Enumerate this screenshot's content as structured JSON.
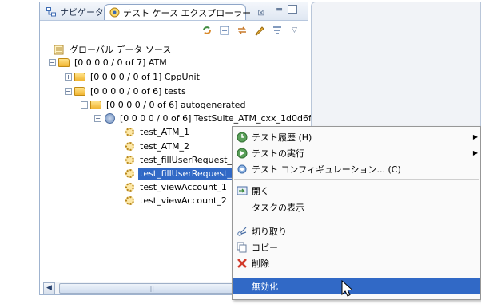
{
  "tabs": {
    "navigator": {
      "label": "ナビゲーター"
    },
    "explorer": {
      "label": "テスト ケース エクスプローラー",
      "close": "⊠"
    }
  },
  "tree": {
    "global_source": "グローバル データ ソース",
    "atm": "[0 0 0 0 / 0 of 7] ATM",
    "cppunit": "[0 0 0 0 / 0 of 1] CppUnit",
    "tests": "[0 0 0 0 / 0 of 6] tests",
    "autogenerated": "[0 0 0 0 / 0 of 6] autogenerated",
    "suite": "[0 0 0 0 / 0 of 6] TestSuite_ATM_cxx_1d0d6f",
    "cases": [
      "test_ATM_1",
      "test_ATM_2",
      "test_fillUserRequest_1",
      "test_fillUserRequest_2",
      "test_viewAccount_1",
      "test_viewAccount_2"
    ]
  },
  "scrollbar": {
    "left_arrow": "◀",
    "thumb_grip": "|||"
  },
  "menu": {
    "history": "テスト履歴 (H)",
    "run": "テストの実行",
    "configure": "テスト コンフィギュレーション... (C)",
    "open": "開く",
    "show_tasks": "タスクの表示",
    "cut": "切り取り",
    "copy": "コピー",
    "delete": "削除",
    "disable": "無効化"
  },
  "colors": {
    "selection": "#3169c6",
    "border": "#9fb3cf"
  }
}
